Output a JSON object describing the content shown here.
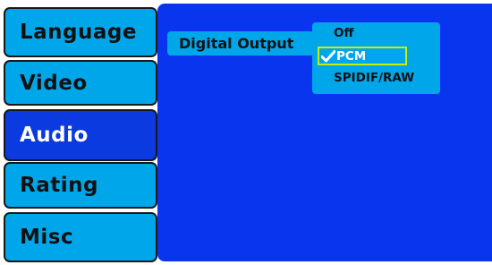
{
  "menu": {
    "tabs": [
      {
        "label": "Language",
        "active": false
      },
      {
        "label": "Video",
        "active": false
      },
      {
        "label": "Audio",
        "active": true
      },
      {
        "label": "Rating",
        "active": false
      },
      {
        "label": "Misc",
        "active": false
      }
    ]
  },
  "audio": {
    "setting_label": "Digital Output",
    "options": [
      "Off",
      "PCM",
      "SPIDIF/RAW"
    ],
    "selected": "PCM"
  },
  "colors": {
    "tab_inactive": "#00a6ea",
    "tab_active": "#0a3ae0",
    "panel": "#0a35ef",
    "highlight_border": "#c6f000"
  }
}
